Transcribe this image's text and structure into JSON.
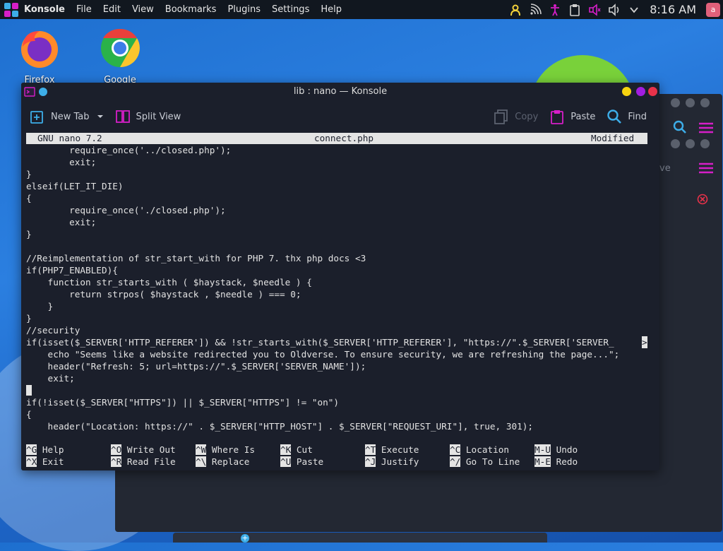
{
  "panel": {
    "app_name": "Konsole",
    "menus": [
      "File",
      "Edit",
      "View",
      "Bookmarks",
      "Plugins",
      "Settings",
      "Help"
    ],
    "clock": "8:16 AM",
    "avatar_letter": "a"
  },
  "desktop": {
    "icons": [
      {
        "label": "Firefox"
      },
      {
        "label": "Google Chrome"
      }
    ],
    "bg_window_fragment": "ve"
  },
  "window": {
    "title": "lib : nano — Konsole",
    "toolbar": {
      "new_tab": "New Tab",
      "split_view": "Split View",
      "copy": "Copy",
      "paste": "Paste",
      "find": "Find"
    }
  },
  "nano": {
    "version": "GNU nano 7.2",
    "filename": "connect.php",
    "status": "Modified",
    "lines": [
      "        require_once('../closed.php');",
      "        exit;",
      "}",
      "elseif(LET_IT_DIE)",
      "{",
      "        require_once('./closed.php');",
      "        exit;",
      "}",
      "",
      "//Reimplementation of str_start_with for PHP 7. thx php docs <3",
      "if(PHP7_ENABLED){",
      "    function str_starts_with ( $haystack, $needle ) {",
      "        return strpos( $haystack , $needle ) === 0;",
      "    }",
      "}",
      "//security",
      "if(isset($_SERVER['HTTP_REFERER']) && !str_starts_with($_SERVER['HTTP_REFERER'], \"https://\".$_SERVER['SERVER_",
      "    echo \"Seems like a website redirected you to Oldverse. To ensure security, we are refreshing the page...\";",
      "    header(\"Refresh: 5; url=https://\".$_SERVER['SERVER_NAME']);",
      "    exit;",
      "",
      "if(!isset($_SERVER[\"HTTPS\"]) || $_SERVER[\"HTTPS\"] != \"on\")",
      "{",
      "    header(\"Location: https://\" . $_SERVER[\"HTTP_HOST\"] . $_SERVER[\"REQUEST_URI\"], true, 301);"
    ],
    "overflow_marker": ">",
    "shortcuts": [
      {
        "key": "^G",
        "label": "Help"
      },
      {
        "key": "^O",
        "label": "Write Out"
      },
      {
        "key": "^W",
        "label": "Where Is"
      },
      {
        "key": "^K",
        "label": "Cut"
      },
      {
        "key": "^T",
        "label": "Execute"
      },
      {
        "key": "^C",
        "label": "Location"
      },
      {
        "key": "M-U",
        "label": "Undo"
      },
      {
        "key": "^X",
        "label": "Exit"
      },
      {
        "key": "^R",
        "label": "Read File"
      },
      {
        "key": "^\\",
        "label": "Replace"
      },
      {
        "key": "^U",
        "label": "Paste"
      },
      {
        "key": "^J",
        "label": "Justify"
      },
      {
        "key": "^/",
        "label": "Go To Line"
      },
      {
        "key": "M-E",
        "label": "Redo"
      }
    ]
  },
  "colors": {
    "accent_magenta": "#d61ec8",
    "accent_blue": "#3daee9",
    "tray_yellow": "#f5d33a",
    "win_yellow": "#f6d20f",
    "win_purple": "#a21de0",
    "win_red": "#e8324a"
  }
}
